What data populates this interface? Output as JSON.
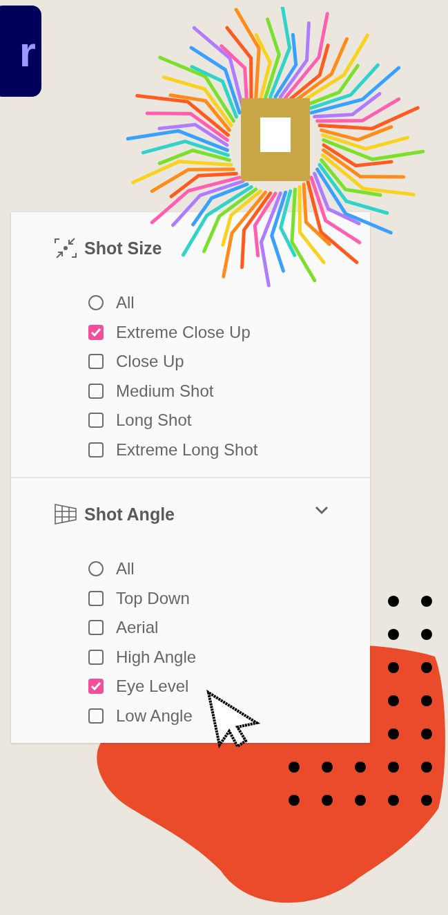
{
  "logo": {
    "text": "r"
  },
  "filter_panel": {
    "sections": [
      {
        "kind": "size",
        "title": "Shot Size",
        "options": [
          {
            "kind": "radio",
            "label": "All",
            "checked": false
          },
          {
            "kind": "checkbox",
            "label": "Extreme Close Up",
            "checked": true
          },
          {
            "kind": "checkbox",
            "label": "Close Up",
            "checked": false
          },
          {
            "kind": "checkbox",
            "label": "Medium Shot",
            "checked": false
          },
          {
            "kind": "checkbox",
            "label": "Long Shot",
            "checked": false
          },
          {
            "kind": "checkbox",
            "label": "Extreme Long Shot",
            "checked": false
          }
        ]
      },
      {
        "kind": "angle",
        "title": "Shot Angle",
        "expanded": true,
        "options": [
          {
            "kind": "radio",
            "label": "All",
            "checked": false
          },
          {
            "kind": "checkbox",
            "label": "Top Down",
            "checked": false
          },
          {
            "kind": "checkbox",
            "label": "Aerial",
            "checked": false
          },
          {
            "kind": "checkbox",
            "label": "High Angle",
            "checked": false
          },
          {
            "kind": "checkbox",
            "label": "Eye Level",
            "checked": true
          },
          {
            "kind": "checkbox",
            "label": "Low Angle",
            "checked": false
          }
        ]
      }
    ]
  }
}
